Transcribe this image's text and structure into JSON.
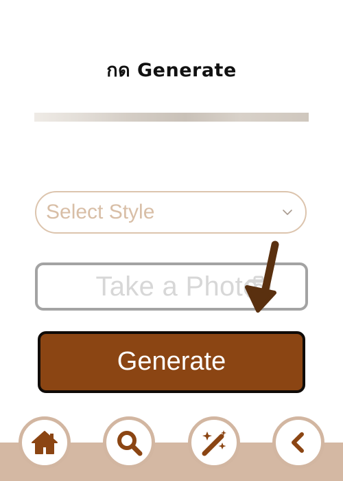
{
  "instruction": {
    "text": "กด Generate"
  },
  "select_style": {
    "label": "Select Style"
  },
  "take_photo": {
    "label": "Take a Photo"
  },
  "generate": {
    "label": "Generate"
  },
  "bottom_nav": {
    "items": [
      {
        "icon": "home-icon"
      },
      {
        "icon": "search-icon"
      },
      {
        "icon": "magic-wand-icon"
      },
      {
        "icon": "back-chevron-icon"
      }
    ]
  },
  "colors": {
    "accent_brown": "#8b4513",
    "nav_tan": "#d4b8a3",
    "select_border": "#dcc4ad",
    "arrow_brown": "#5a300f"
  }
}
